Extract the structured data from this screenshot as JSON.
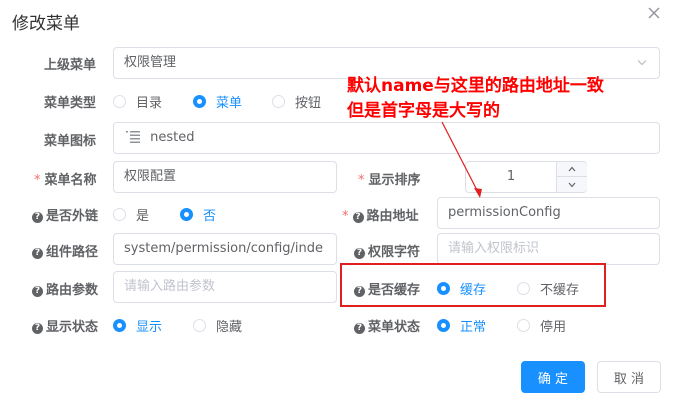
{
  "dialog": {
    "title": "修改菜单"
  },
  "form": {
    "parent_menu": {
      "label": "上级菜单",
      "value": "权限管理"
    },
    "menu_type": {
      "label": "菜单类型",
      "options": [
        "目录",
        "菜单",
        "按钮"
      ],
      "selected": "菜单"
    },
    "menu_icon": {
      "label": "菜单图标",
      "value": "nested"
    },
    "menu_name": {
      "label": "菜单名称",
      "value": "权限配置"
    },
    "sort_order": {
      "label": "显示排序",
      "value": "1"
    },
    "external_link": {
      "label": "是否外链",
      "options": [
        "是",
        "否"
      ],
      "selected": "否"
    },
    "route_path": {
      "label": "路由地址",
      "value": "permissionConfig"
    },
    "component_path": {
      "label": "组件路径",
      "value": "system/permission/config/inde"
    },
    "permission": {
      "label": "权限字符",
      "placeholder": "请输入权限标识"
    },
    "route_params": {
      "label": "路由参数",
      "placeholder": "请输入路由参数"
    },
    "cache": {
      "label": "是否缓存",
      "options": [
        "缓存",
        "不缓存"
      ],
      "selected": "缓存"
    },
    "visible": {
      "label": "显示状态",
      "options": [
        "显示",
        "隐藏"
      ],
      "selected": "显示"
    },
    "status": {
      "label": "菜单状态",
      "options": [
        "正常",
        "停用"
      ],
      "selected": "正常"
    }
  },
  "buttons": {
    "confirm": "确 定",
    "cancel": "取 消"
  },
  "annotation": {
    "line1": "默认name与这里的路由地址一致",
    "line2": "但是首字母是大写的",
    "color": "#ff0000"
  },
  "colors": {
    "primary": "#1890ff",
    "required": "#f56c6c",
    "border": "#dcdfe6"
  }
}
